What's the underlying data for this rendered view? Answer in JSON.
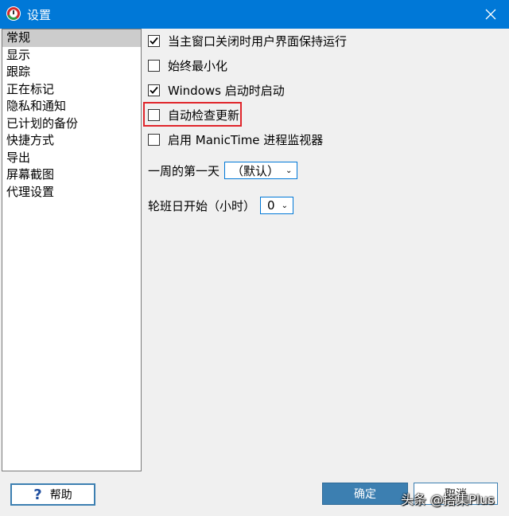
{
  "window": {
    "title": "设置",
    "accent": "#0078d7"
  },
  "sidebar": {
    "items": [
      {
        "label": "常规",
        "selected": true
      },
      {
        "label": "显示"
      },
      {
        "label": "跟踪"
      },
      {
        "label": "正在标记"
      },
      {
        "label": "隐私和通知"
      },
      {
        "label": "已计划的备份"
      },
      {
        "label": "快捷方式"
      },
      {
        "label": "导出"
      },
      {
        "label": "屏幕截图"
      },
      {
        "label": "代理设置"
      }
    ]
  },
  "general": {
    "options": [
      {
        "label": "当主窗口关闭时用户界面保持运行",
        "checked": true
      },
      {
        "label": "始终最小化",
        "checked": false
      },
      {
        "label": "Windows 启动时启动",
        "checked": true
      },
      {
        "label": "自动检查更新",
        "checked": false,
        "highlighted": true
      },
      {
        "label": "启用 ManicTime 进程监视器",
        "checked": false
      }
    ],
    "week_start": {
      "label": "一周的第一天",
      "value": "（默认）"
    },
    "shift_start": {
      "label": "轮班日开始（小时）",
      "value": "0"
    }
  },
  "buttons": {
    "help": "帮助",
    "ok": "确定",
    "cancel": "取消"
  },
  "watermark": "头条 @搭集Plus",
  "icons": {
    "close": "close-icon",
    "help": "question-icon",
    "app": "manictime-icon"
  }
}
